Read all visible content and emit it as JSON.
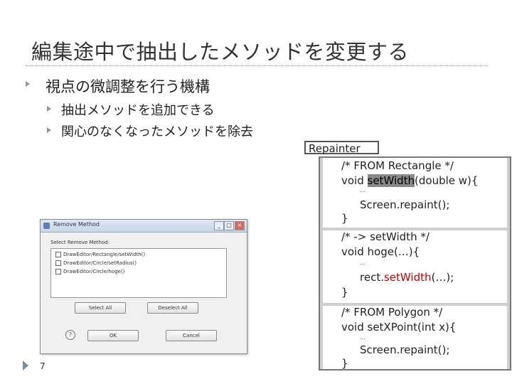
{
  "slide": {
    "title": "編集途中で抽出したメソッドを変更する",
    "bullet_main": "視点の微調整を行う機構",
    "sub_bullets": [
      "抽出メソッドを追加できる",
      "関心のなくなったメソッドを除去"
    ],
    "page_number": "7"
  },
  "dialog": {
    "title": "Remove Method",
    "window_buttons": [
      "_",
      "□",
      "×"
    ],
    "label": "Select Remove Method:",
    "items": [
      "DrawEditor/Rectangle/setWidth()",
      "DrawEditor/Circle/setRadius()",
      "DrawEditor/Circle/hoge()"
    ],
    "buttons": {
      "select_all": "Select All",
      "deselect_all": "Deselect All",
      "ok": "OK",
      "cancel": "Cancel"
    },
    "help": "?"
  },
  "repainter": {
    "tab_label": "Repainter",
    "ellipsis": "…",
    "blocks": [
      {
        "comment": "/* FROM Rectangle */",
        "sig_pre": "void ",
        "sig_hl": "setWidth",
        "sig_post": "(double w){",
        "body_pre": "Screen.repaint();",
        "body_red": "",
        "body_post": "",
        "close": "}"
      },
      {
        "comment": "/* -> setWidth */",
        "sig_pre": "void hoge(…){",
        "sig_hl": "",
        "sig_post": "",
        "body_pre": "rect.",
        "body_red": "setWidth",
        "body_post": "(…);",
        "close": "}"
      },
      {
        "comment": "/* FROM Polygon */",
        "sig_pre": "void setXPoint(int x){",
        "sig_hl": "",
        "sig_post": "",
        "body_pre": "Screen.repaint();",
        "body_red": "",
        "body_post": "",
        "close": "}"
      }
    ],
    "colors": {
      "method_red": "#c00000"
    }
  }
}
